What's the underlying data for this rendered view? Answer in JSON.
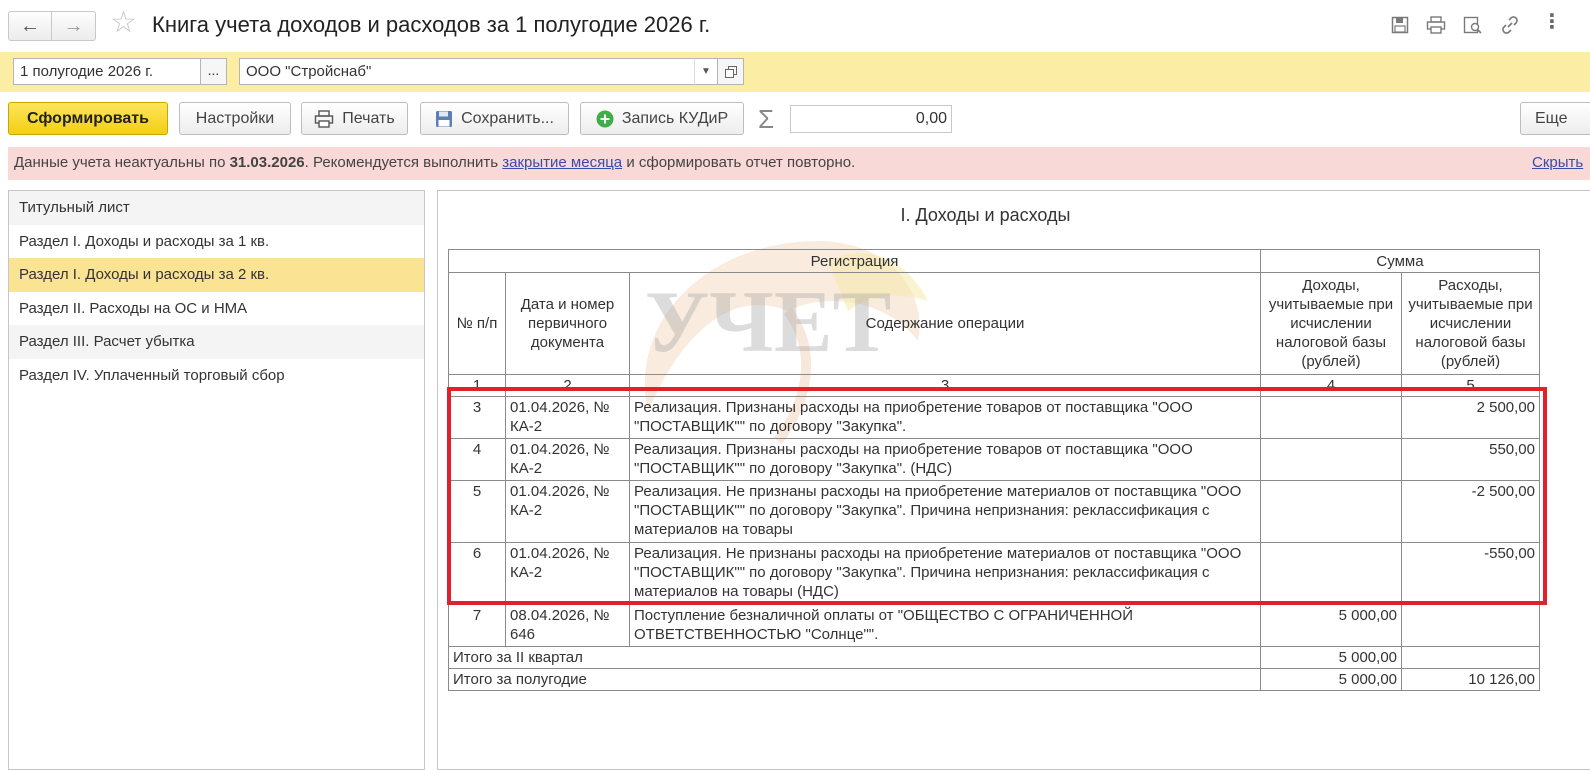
{
  "header": {
    "title": "Книга учета доходов и расходов за 1 полугодие 2026 г.",
    "icons": [
      "arrow-left-icon",
      "arrow-right-icon",
      "star-icon",
      "save-icon",
      "print-icon",
      "preview-icon",
      "link-icon",
      "more-vertical-icon"
    ]
  },
  "filters": {
    "period_value": "1 полугодие 2026 г.",
    "period_picker": "...",
    "organization_value": "ООО \"Стройснаб\""
  },
  "toolbar": {
    "generate_label": "Сформировать",
    "settings_label": "Настройки",
    "print_label": "Печать",
    "save_label": "Сохранить...",
    "record_label": "Запись КУДиР",
    "sigma": "Σ",
    "sum_value": "0,00",
    "more_label": "Еще"
  },
  "warning": {
    "text_before": "Данные учета неактуальны по ",
    "date": "31.03.2026",
    "text_middle": ". Рекомендуется выполнить ",
    "link": "закрытие месяца",
    "text_after": " и сформировать отчет повторно.",
    "hide_link": "Скрыть"
  },
  "sidebar": {
    "items": [
      {
        "label": "Титульный лист"
      },
      {
        "label": "Раздел I. Доходы и расходы за 1 кв."
      },
      {
        "label": "Раздел I. Доходы и расходы за 2 кв."
      },
      {
        "label": "Раздел II. Расходы на ОС и НМА"
      },
      {
        "label": "Раздел III. Расчет убытка"
      },
      {
        "label": "Раздел IV. Уплаченный торговый сбор"
      }
    ],
    "selected_index": 2
  },
  "report": {
    "watermark": "УЧЕТ",
    "title": "I. Доходы и расходы",
    "group_headers": {
      "registration": "Регистрация",
      "sum": "Сумма"
    },
    "columns": [
      "№ п/п",
      "Дата и номер первичного документа",
      "Содержание операции",
      "Доходы, учитываемые при исчислении налоговой базы (рублей)",
      "Расходы, учитываемые при исчислении налоговой базы (рублей)"
    ],
    "column_numbers": [
      "1",
      "2",
      "3",
      "4",
      "5"
    ],
    "rows": [
      {
        "n": "3",
        "doc": "01.04.2026, № КА-2",
        "content": "Реализация. Признаны расходы на приобретение товаров от поставщика \"ООО \"ПОСТАВЩИК\"\" по договору \"Закупка\".",
        "income": "",
        "expense": "2 500,00"
      },
      {
        "n": "4",
        "doc": "01.04.2026, № КА-2",
        "content": "Реализация. Признаны расходы на приобретение товаров от поставщика \"ООО \"ПОСТАВЩИК\"\" по договору \"Закупка\". (НДС)",
        "income": "",
        "expense": "550,00"
      },
      {
        "n": "5",
        "doc": "01.04.2026, № КА-2",
        "content": "Реализация. Не признаны расходы на приобретение материалов от поставщика \"ООО \"ПОСТАВЩИК\"\" по договору \"Закупка\". Причина непризнания: реклассификация с материалов на товары",
        "income": "",
        "expense": "-2 500,00"
      },
      {
        "n": "6",
        "doc": "01.04.2026, № КА-2",
        "content": "Реализация. Не признаны расходы на приобретение материалов от поставщика \"ООО \"ПОСТАВЩИК\"\" по договору \"Закупка\". Причина непризнания: реклассификация с материалов на товары (НДС)",
        "income": "",
        "expense": "-550,00"
      },
      {
        "n": "7",
        "doc": "08.04.2026, № 646",
        "content": "Поступление безналичной оплаты от \"ОБЩЕСТВО С ОГРАНИЧЕННОЙ ОТВЕТСТВЕННОСТЬЮ \"Солнце\"\".",
        "income": "5 000,00",
        "expense": ""
      }
    ],
    "totals": [
      {
        "label": "Итого за II квартал",
        "income": "5 000,00",
        "expense": ""
      },
      {
        "label": "Итого за полугодие",
        "income": "5 000,00",
        "expense": "10 126,00"
      }
    ],
    "highlight_color": "#e0202a"
  }
}
